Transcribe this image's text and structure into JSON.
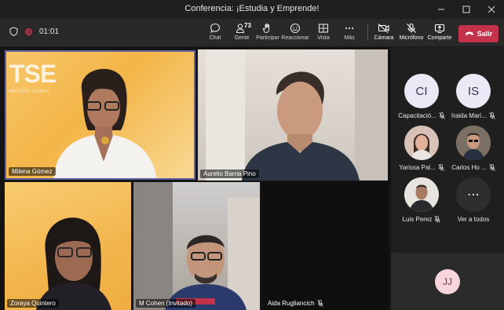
{
  "window": {
    "title": "Conferencia: ¡Estudia y Emprende!"
  },
  "toolbar": {
    "timer": "01:01",
    "chat": "Chat",
    "people": "Gente",
    "people_count": "73",
    "participate": "Participar",
    "react": "Reaccionar",
    "view": "Vista",
    "more": "Más",
    "camera": "Cámara",
    "mic": "Micrófono",
    "share": "Comparte",
    "leave": "Salir"
  },
  "tiles": [
    {
      "name": "Milena Gómez",
      "logo_text": "TSE",
      "logo_sub": "INSTITUTO TÉCNICO"
    },
    {
      "name": "Aurelio Barria Pino"
    },
    {
      "name": "Zoraya Quintero"
    },
    {
      "name": "M Cohen (Invitado)"
    },
    {
      "name": "Aida Rugliancich"
    }
  ],
  "sidebar": {
    "participants": [
      {
        "initials": "CI",
        "name": "Capacitació..."
      },
      {
        "initials": "IS",
        "name": "Iraida Marí..."
      },
      {
        "initials": "",
        "name": "Yarissa Pal..."
      },
      {
        "initials": "",
        "name": "Carlos Ho ..."
      },
      {
        "initials": "",
        "name": "Luis Perez"
      },
      {
        "initials": "⋯",
        "name": "Ver a todos"
      }
    ],
    "self_initials": "JJ"
  }
}
